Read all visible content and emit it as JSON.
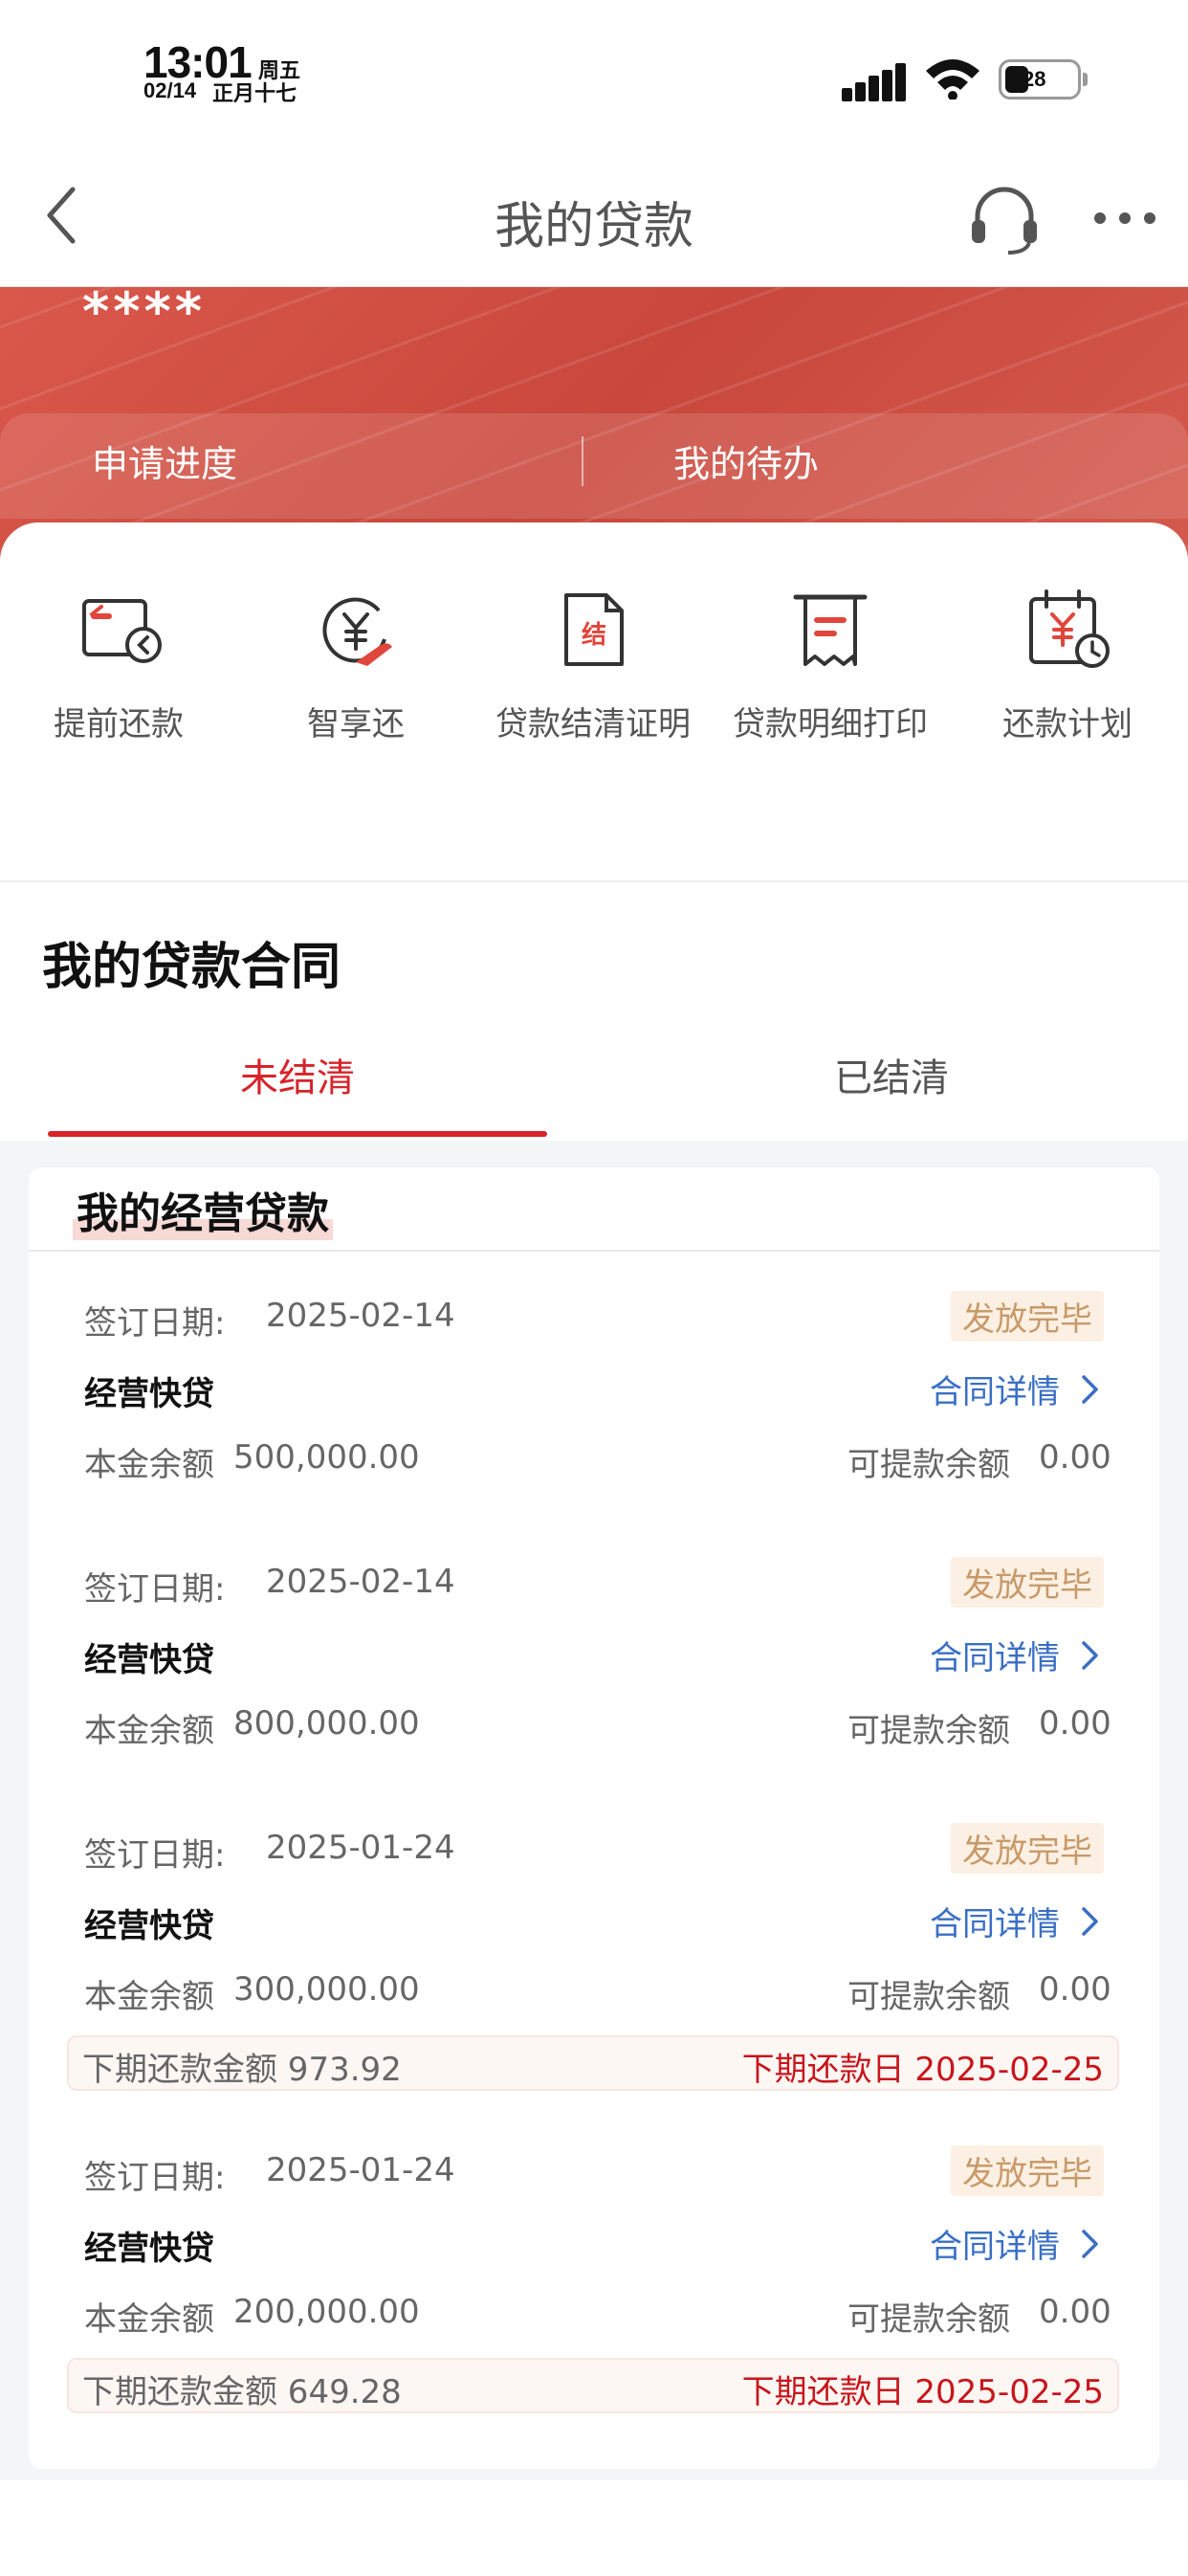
{
  "status_bar": {
    "time": "13:01",
    "weekday": "周五",
    "date": "02/14",
    "lunar": "正月十七",
    "battery": "28"
  },
  "nav": {
    "title": "我的贷款",
    "back_icon": "chevron-left-icon",
    "service_icon": "headset-icon",
    "more_icon": "more-dots-icon"
  },
  "banner": {
    "masked_text": "****",
    "links": [
      "申请进度",
      "我的待办"
    ]
  },
  "quick_actions": [
    {
      "label": "提前还款",
      "icon": "prepay-card-icon"
    },
    {
      "label": "智享还",
      "icon": "yuan-hand-icon"
    },
    {
      "label": "贷款结清证明",
      "icon": "settlement-doc-icon"
    },
    {
      "label": "贷款明细打印",
      "icon": "receipt-print-icon"
    },
    {
      "label": "还款计划",
      "icon": "yuan-calendar-icon"
    }
  ],
  "contracts": {
    "title": "我的贷款合同",
    "tabs": [
      "未结清",
      "已结清"
    ],
    "active_tab": "未结清",
    "card_title": "我的经营贷款",
    "labels": {
      "signed_date": "签订日期:",
      "principal": "本金余额",
      "withdrawable": "可提款余额",
      "detail_link": "合同详情"
    },
    "loans": [
      {
        "date": "2025-02-14",
        "status": "发放完毕",
        "product": "经营快贷",
        "principal": "500,000.00",
        "withdrawable": "0.00"
      },
      {
        "date": "2025-02-14",
        "status": "发放完毕",
        "product": "经营快贷",
        "principal": "800,000.00",
        "withdrawable": "0.00"
      },
      {
        "date": "2025-01-24",
        "status": "发放完毕",
        "product": "经营快贷",
        "principal": "300,000.00",
        "withdrawable": "0.00",
        "next_amount": "下期还款金额 973.92",
        "next_date": "下期还款日 2025-02-25"
      },
      {
        "date": "2025-01-24",
        "status": "发放完毕",
        "product": "经营快贷",
        "principal": "200,000.00",
        "withdrawable": "0.00",
        "next_amount": "下期还款金额 649.28",
        "next_date": "下期还款日 2025-02-25"
      }
    ]
  },
  "colors": {
    "accent_red": "#d8232a",
    "banner_red": "#cd4a3f",
    "link_blue": "#3a6fc5",
    "badge_gold": "#c89a6a"
  }
}
